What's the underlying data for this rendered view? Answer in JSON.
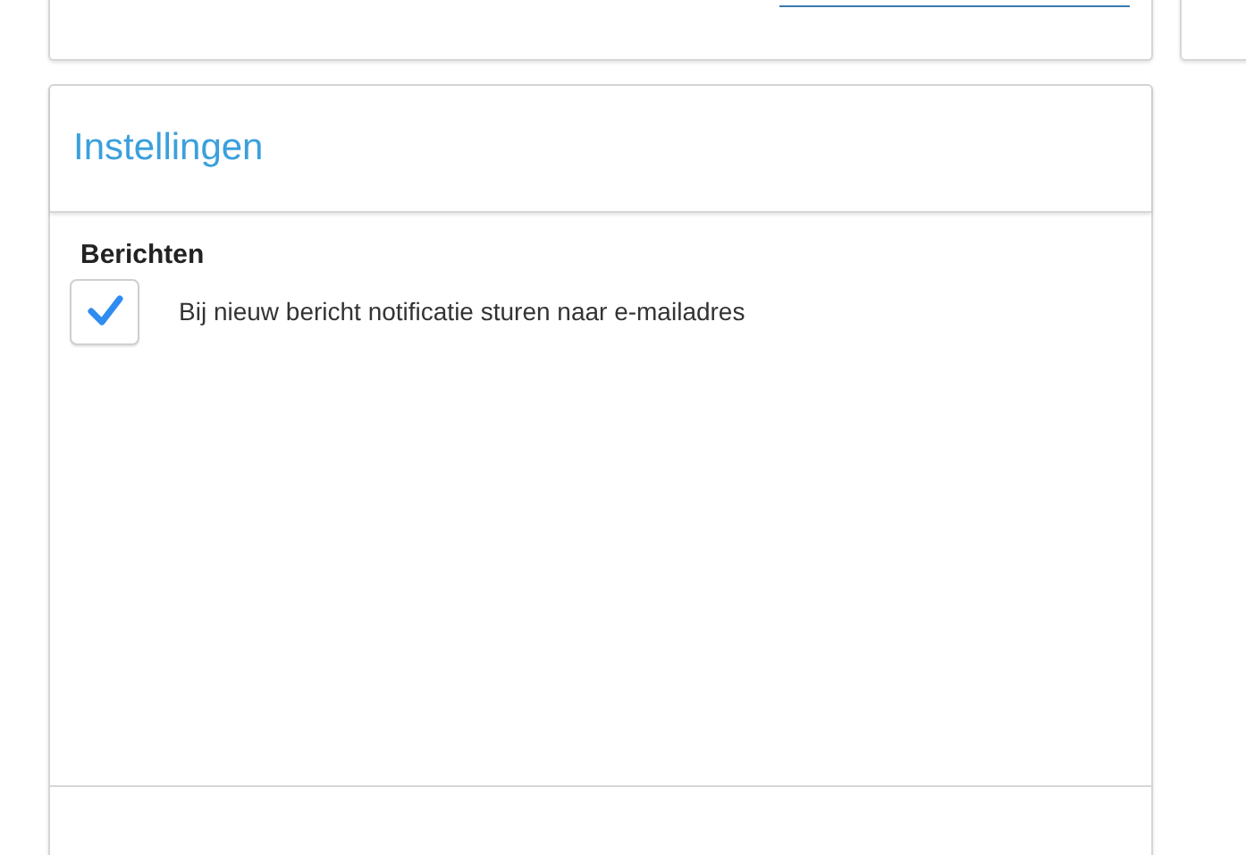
{
  "panel": {
    "title": "Instellingen"
  },
  "sections": [
    {
      "heading": "Berichten",
      "options": [
        {
          "label": "Bij nieuw bericht notificatie sturen naar e-mailadres",
          "checked": true
        }
      ]
    }
  ]
}
